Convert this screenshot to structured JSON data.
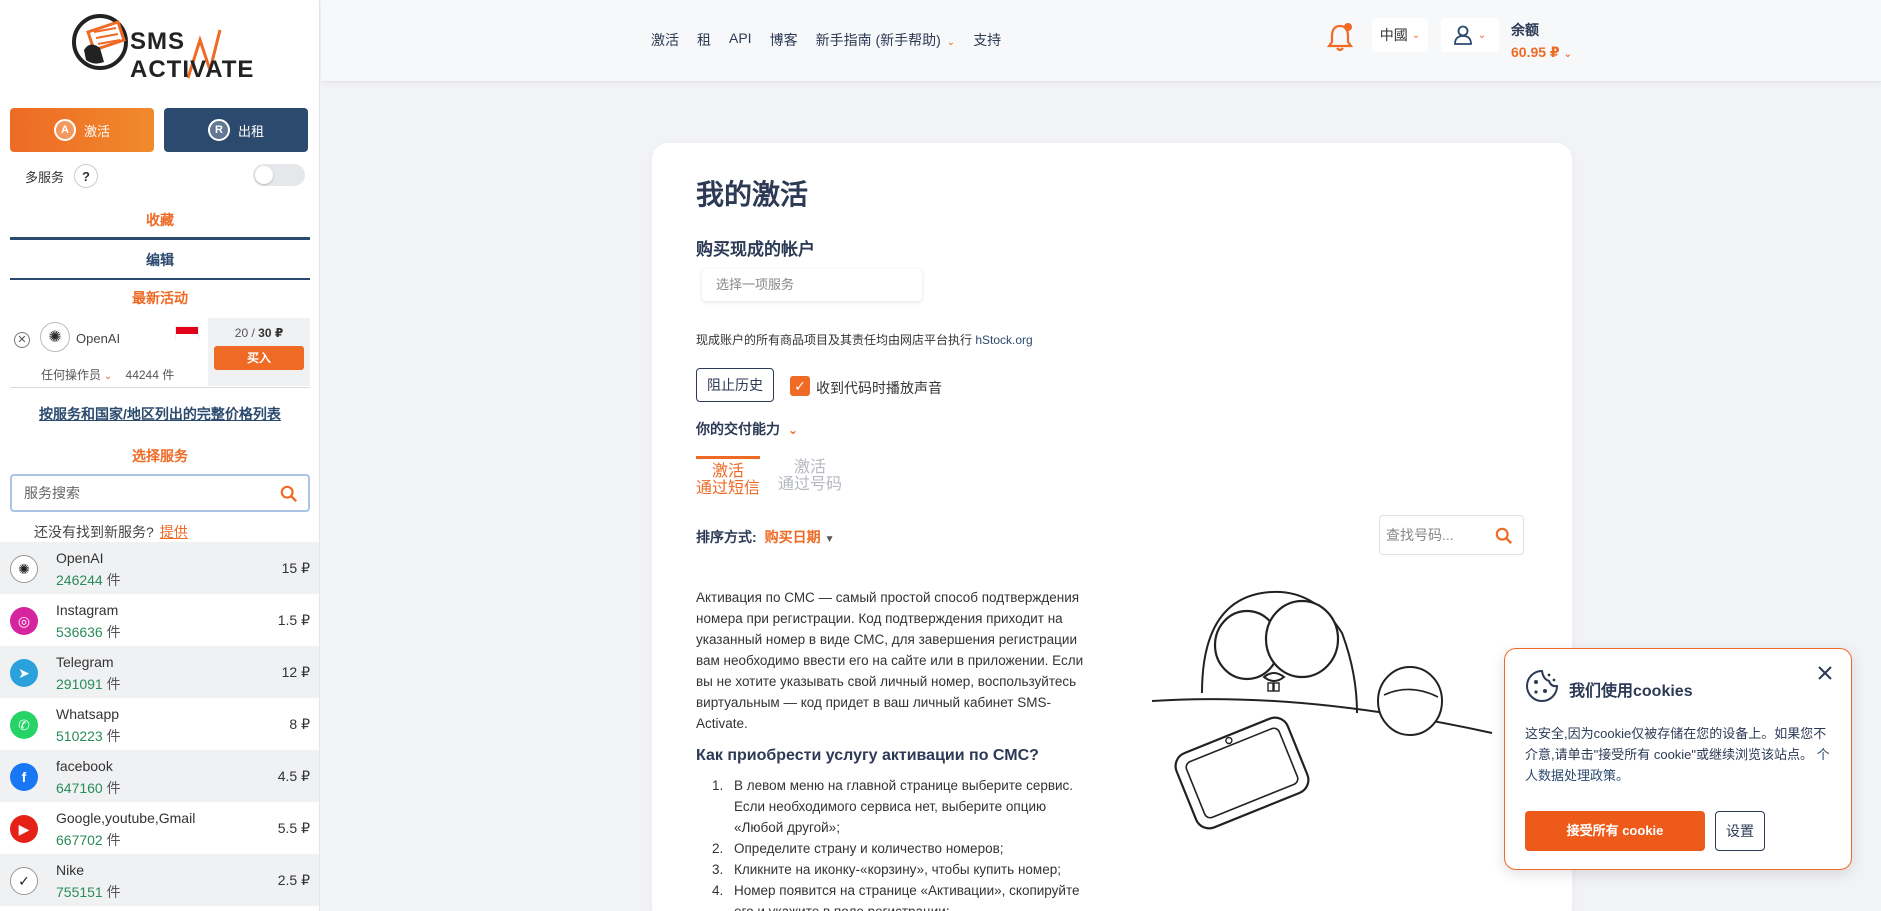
{
  "brand": {
    "logo_line1": "SMS",
    "logo_line2": "ACTIVATE"
  },
  "sidebar": {
    "activate_button": "激活",
    "rent_button": "出租",
    "multi_service_label": "多服务",
    "help_glyph": "?",
    "favorites_tab": "收藏",
    "edit_tab": "编辑",
    "latest_activity_title": "最新活动",
    "recent": {
      "close_glyph": "✕",
      "service": "OpenAI",
      "operator": "任何操作员",
      "count": "44244 件",
      "price_current": "20",
      "price_sep": "/",
      "price_max": "30 ₽",
      "buy_button": "买入"
    },
    "price_list_link": "按服务和国家/地区列出的完整价格列表",
    "choose_service_title": "选择服务",
    "search_placeholder": "服务搜索",
    "not_found_text": "还没有找到新服务?",
    "suggest_link": "提供",
    "count_unit": "件",
    "services": [
      {
        "name": "OpenAI",
        "count": "246244",
        "price": "15 ₽",
        "icon": "openai-icon",
        "color": "#ffffff",
        "glyph": "✺"
      },
      {
        "name": "Instagram",
        "count": "536636",
        "price": "1.5 ₽",
        "icon": "instagram-icon",
        "color": "#d6249f",
        "glyph": "◎"
      },
      {
        "name": "Telegram",
        "count": "291091",
        "price": "12 ₽",
        "icon": "telegram-icon",
        "color": "#2aa1da",
        "glyph": "➤"
      },
      {
        "name": "Whatsapp",
        "count": "510223",
        "price": "8 ₽",
        "icon": "whatsapp-icon",
        "color": "#25d366",
        "glyph": "✆"
      },
      {
        "name": "facebook",
        "count": "647160",
        "price": "4.5 ₽",
        "icon": "facebook-icon",
        "color": "#1877f2",
        "glyph": "f"
      },
      {
        "name": "Google,youtube,Gmail",
        "count": "667702",
        "price": "5.5 ₽",
        "icon": "youtube-icon",
        "color": "#e62117",
        "glyph": "▶"
      },
      {
        "name": "Nike",
        "count": "755151",
        "price": "2.5 ₽",
        "icon": "nike-icon",
        "color": "#ffffff",
        "glyph": "✓"
      }
    ]
  },
  "header": {
    "nav": [
      "激活",
      "租",
      "API",
      "博客",
      "新手指南 (新手帮助)",
      "支持"
    ],
    "language": "中國",
    "balance_label": "余额",
    "balance_value": "60.95 ₽"
  },
  "main": {
    "title": "我的激活",
    "subtitle": "购买现成的帐户",
    "select_placeholder": "选择一项服务",
    "note": "现成账户的所有商品项目及其责任均由网店平台执行",
    "note_link": "hStock.org",
    "block_history_button": "阻止历史",
    "sound_checkbox_label": "收到代码时播放声音",
    "sound_checked": true,
    "delivery_label": "你的交付能力",
    "tab_sms_line1": "激活",
    "tab_sms_line2": "通过短信",
    "tab_number_line1": "激活",
    "tab_number_line2": "通过号码",
    "sort_label": "排序方式:",
    "sort_value": "购买日期",
    "number_search_placeholder": "查找号码...",
    "description": "Активация по СМС — самый простой способ подтверждения номера при регистрации. Код подтверждения приходит на указанный номер в виде СМС, для завершения регистрации вам необходимо ввести его на сайте или в приложении. Если вы не хотите указывать свой личный номер, воспользуйтесь виртуальным — код придет в ваш личный кабинет SMS-Activate.",
    "howto_title": "Как приобрести услугу активации по СМС?",
    "steps": [
      {
        "n": "1.",
        "text": "В левом меню на главной странице выберите сервис. Если необходимого сервиса нет, выберите опцию «Любой другой»;"
      },
      {
        "n": "2.",
        "text": "Определите страну и количество номеров;"
      },
      {
        "n": "3.",
        "text": "Кликните на иконку-«корзину», чтобы купить номер;"
      },
      {
        "n": "4.",
        "text": "Номер появится на странице «Активации», скопируйте его и укажите в поле регистрации;"
      }
    ]
  },
  "cookie": {
    "title": "我们使用cookies",
    "text": "这安全,因为cookie仅被存储在您的设备上。如果您不介意,请单击\"接受所有 cookie\"或继续浏览该站点。",
    "policy_link": "个人数据处理政策。",
    "accept_button": "接受所有 cookie",
    "settings_button": "设置"
  },
  "colors": {
    "accent": "#ee6a25",
    "navy": "#2c3a55",
    "count_green": "#2a8c5a"
  }
}
